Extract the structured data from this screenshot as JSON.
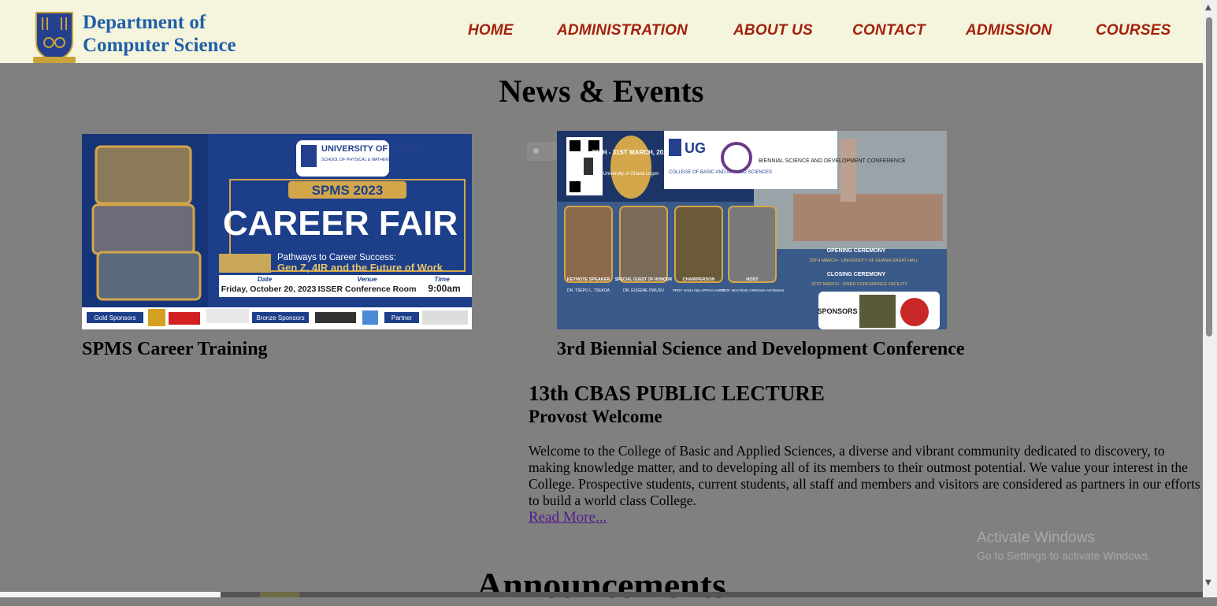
{
  "header": {
    "dept_line1": "Department of",
    "dept_line2": "Computer Science",
    "nav": [
      "HOME",
      "ADMINISTRATION",
      "ABOUT US",
      "CONTACT",
      "ADMISSION",
      "COURSES"
    ]
  },
  "news": {
    "title": "News & Events",
    "items": [
      {
        "caption": "SPMS Career Training",
        "poster": {
          "university": "UNIVERSITY OF GHANA",
          "school": "SCHOOL OF PHYSICAL & MATHEMATICAL SCIENCES",
          "event": "SPMS 2023",
          "headline": "CAREER FAIR",
          "theme_line1": "Pathways to Career Success:",
          "theme_line2": "Gen Z, 4IR and the Future of Work",
          "date_label": "Date",
          "date": "Friday, October 20, 2023",
          "venue_label": "Venue",
          "venue": "ISSER Conference Room",
          "time_label": "Time",
          "time": "9:00am",
          "gold": "Gold Sponsors",
          "bronze": "Bronze Sponsors",
          "partner": "Partner"
        }
      },
      {
        "caption": "3rd Biennial Science and Development Conference",
        "poster": {
          "dates": "29TH - 31ST MARCH, 2023",
          "venue": "University of Ghana Legon",
          "ug": "UG",
          "college": "COLLEGE OF BASIC AND APPLIED SCIENCES",
          "conference": "BIENNIAL SCIENCE AND DEVELOPMENT CONFERENCE",
          "speakers": [
            {
              "role": "KEYNOTE SPEAKER",
              "name": "DR. TSEPO L. TSEKOA"
            },
            {
              "role": "SPECIAL GUEST OF HONOUR",
              "name": "DR. EUGENE OWUSU"
            },
            {
              "role": "CHAIRPERSON",
              "name": "PROF. NANA ABA APPIAH AMFO"
            },
            {
              "role": "HOST",
              "name": "PROF. BOATENG ONWONA-AGYEMAN"
            }
          ],
          "opening": "OPENING CEREMONY",
          "opening_detail": "29TH MARCH - UNIVERSITY OF GHANA GREAT HALL",
          "closing": "CLOSING CEREMONY",
          "closing_detail": "31ST MARCH - ISSER CONFERENCE FACILITY",
          "sponsors": "SPONSORS"
        }
      }
    ]
  },
  "lecture": {
    "title": "13th CBAS PUBLIC LECTURE",
    "subtitle": "Provost Welcome",
    "body": "Welcome to the College of Basic and Applied Sciences, a diverse and vibrant community dedicated to discovery, to making knowledge matter, and to developing all of its members to their outmost potential. We value your interest in the College. Prospective students, current students, all staff and members and visitors are considered as partners in our efforts to build a world class College.",
    "read_more": "Read More..."
  },
  "announcements": {
    "title": "Announcements"
  },
  "watermark": {
    "line1": "Activate Windows",
    "line2": "Go to Settings to activate Windows."
  },
  "colors": {
    "nav": "#a3210d",
    "dept": "#1f5fa8",
    "header_bg": "#f5f4dc",
    "overlay_bg": "#808080"
  }
}
